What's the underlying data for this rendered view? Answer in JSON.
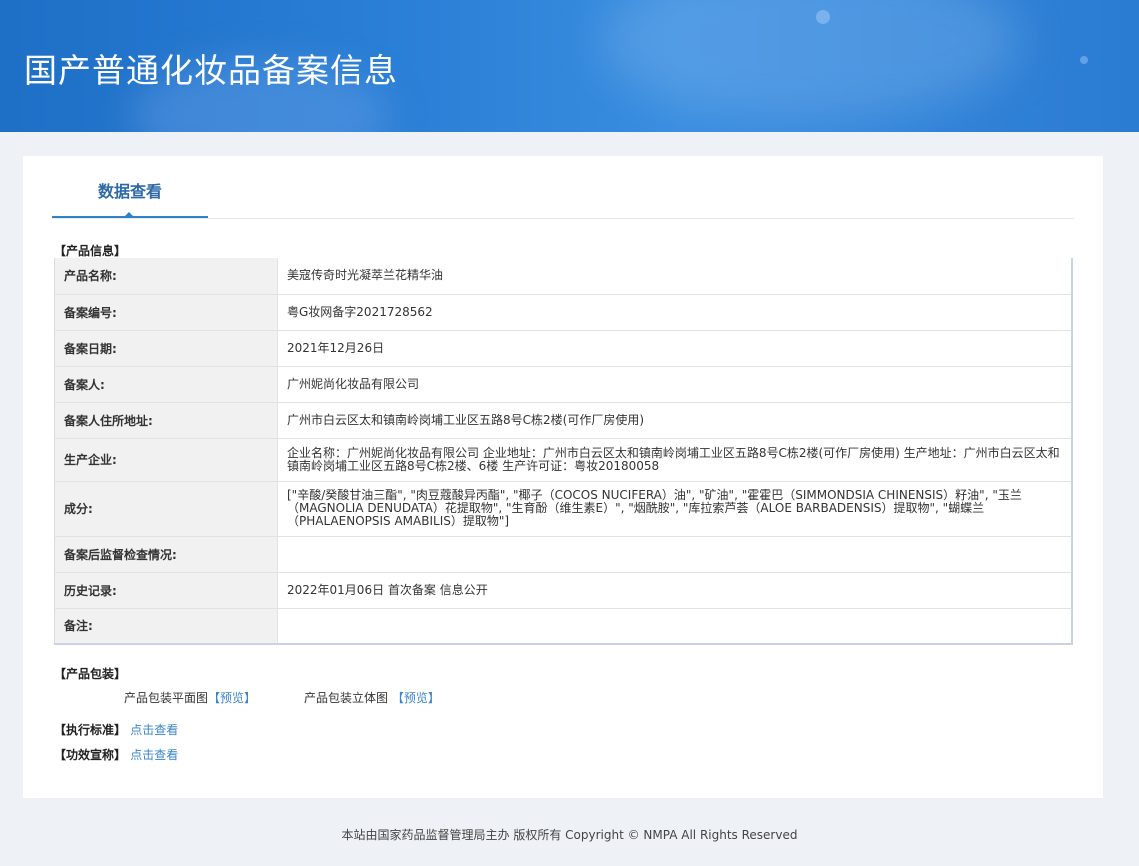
{
  "banner": {
    "title": "国产普通化妆品备案信息"
  },
  "tabs": [
    {
      "label": "数据查看"
    }
  ],
  "product_info": {
    "section_label": "【产品信息】",
    "rows": [
      {
        "label": "产品名称:",
        "value": "美寇传奇时光凝萃兰花精华油"
      },
      {
        "label": "备案编号:",
        "value": "粤G妆网备字2021728562"
      },
      {
        "label": "备案日期:",
        "value": "2021年12月26日"
      },
      {
        "label": "备案人:",
        "value": "广州妮尚化妆品有限公司"
      },
      {
        "label": "备案人住所地址:",
        "value": "广州市白云区太和镇南岭岗埔工业区五路8号C栋2楼(可作厂房使用)"
      },
      {
        "label": "生产企业:",
        "value": "企业名称：广州妮尚化妆品有限公司 企业地址：广州市白云区太和镇南岭岗埔工业区五路8号C栋2楼(可作厂房使用)  生产地址：广州市白云区太和镇南岭岗埔工业区五路8号C栋2楼、6楼 生产许可证：粤妆20180058"
      },
      {
        "label": "成分:",
        "value": "[\"辛酸/癸酸甘油三酯\", \"肉豆蔻酸异丙酯\", \"椰子（COCOS NUCIFERA）油\", \"矿油\", \"霍霍巴（SIMMONDSIA CHINENSIS）籽油\", \"玉兰（MAGNOLIA DENUDATA）花提取物\", \"生育酚（维生素E）\", \"烟酰胺\", \"库拉索芦荟（ALOE BARBADENSIS）提取物\", \"蝴蝶兰（PHALAENOPSIS AMABILIS）提取物\"]"
      },
      {
        "label": "备案后监督检查情况:",
        "value": ""
      },
      {
        "label": "历史记录:",
        "value": "2022年01月06日 首次备案 信息公开"
      },
      {
        "label": "备注:",
        "value": ""
      }
    ]
  },
  "packaging": {
    "section_label": "【产品包装】",
    "flat_label": "产品包装平面图",
    "flat_link": "【预览】",
    "stereo_label": "产品包装立体图",
    "stereo_link": "【预览】"
  },
  "standard": {
    "label": "【执行标准】",
    "link": "点击查看"
  },
  "efficacy": {
    "label": "【功效宣称】",
    "link": "点击查看"
  },
  "footer": {
    "text": "本站由国家药品监督管理局主办 版权所有 Copyright © NMPA All Rights Reserved"
  }
}
